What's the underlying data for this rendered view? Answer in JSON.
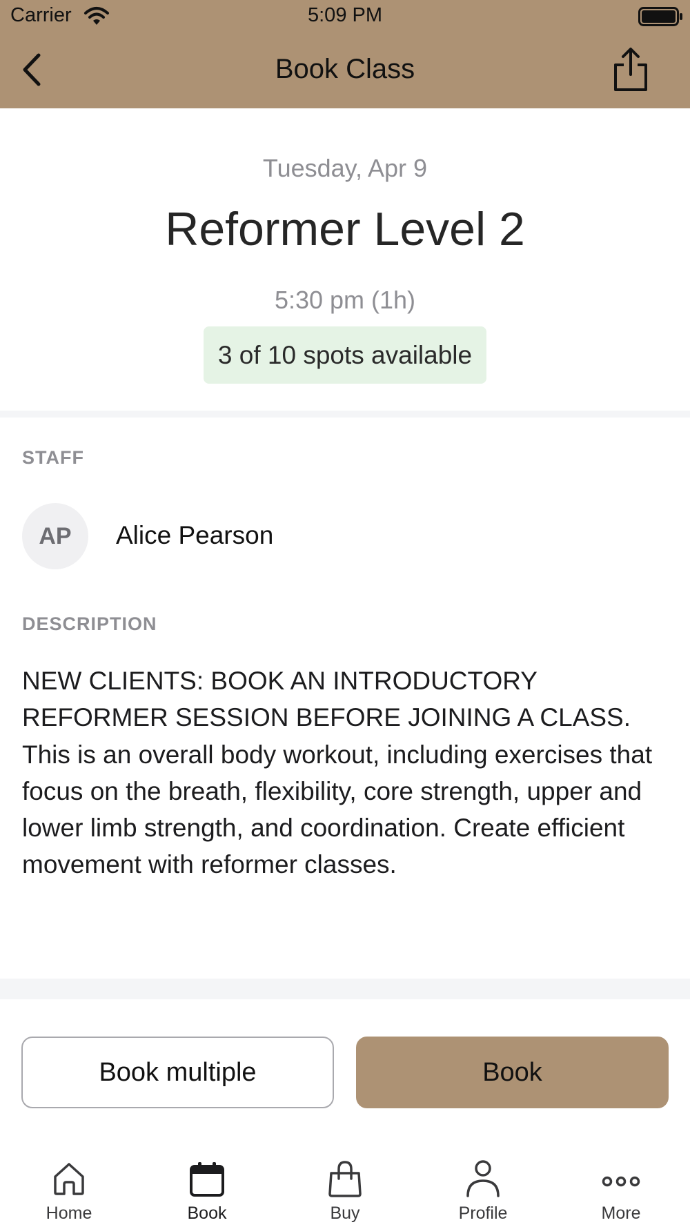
{
  "status_bar": {
    "carrier": "Carrier",
    "time": "5:09 PM"
  },
  "nav": {
    "title": "Book Class",
    "back_icon": "chevron-left-icon",
    "share_icon": "share-icon"
  },
  "class_info": {
    "date": "Tuesday, Apr 9",
    "name": "Reformer Level 2",
    "time": "5:30 pm (1h)",
    "availability": "3 of 10 spots available"
  },
  "staff": {
    "label": "STAFF",
    "initials": "AP",
    "name": "Alice Pearson"
  },
  "description": {
    "label": "DESCRIPTION",
    "text": "NEW CLIENTS: BOOK AN INTRODUCTORY REFORMER SESSION BEFORE JOINING A CLASS. This is an overall body workout, including exercises that focus on the breath, flexibility, core strength, upper and lower limb strength, and coordination. Create efficient movement with reformer classes."
  },
  "actions": {
    "book_multiple": "Book multiple",
    "book": "Book"
  },
  "tabbar": {
    "items": [
      {
        "label": "Home",
        "icon": "home-icon"
      },
      {
        "label": "Book",
        "icon": "calendar-icon",
        "active": true
      },
      {
        "label": "Buy",
        "icon": "shopping-bag-icon"
      },
      {
        "label": "Profile",
        "icon": "person-icon"
      },
      {
        "label": "More",
        "icon": "more-dots-icon"
      }
    ]
  },
  "colors": {
    "brand": "#ad9274",
    "availability_bg": "#e5f3e5",
    "muted_text": "#8e8e93"
  }
}
